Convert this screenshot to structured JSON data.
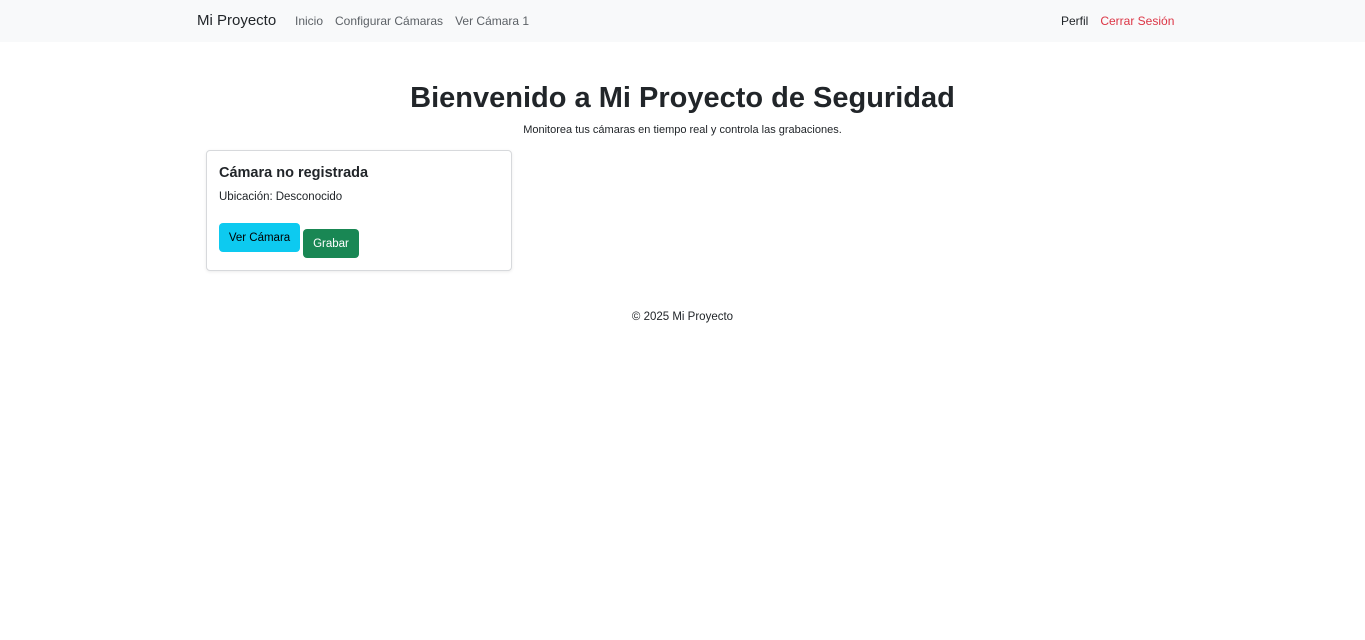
{
  "navbar": {
    "brand": "Mi Proyecto",
    "links": [
      "Inicio",
      "Configurar Cámaras",
      "Ver Cámara 1"
    ],
    "profile": "Perfil",
    "logout": "Cerrar Sesión"
  },
  "hero": {
    "title": "Bienvenido a Mi Proyecto de Seguridad",
    "subtitle": "Monitorea tus cámaras en tiempo real y controla las grabaciones."
  },
  "camera_card": {
    "title": "Cámara no registrada",
    "location_label": "Ubicación:",
    "location_value": "Desconocido",
    "view_button": "Ver Cámara",
    "record_button": "Grabar"
  },
  "footer": {
    "text": "© 2025 Mi Proyecto"
  },
  "colors": {
    "navbar_bg": "#f8f9fa",
    "logout": "#dc3545",
    "view_button_bg": "#0dcaf0",
    "record_button_bg": "#198754"
  }
}
